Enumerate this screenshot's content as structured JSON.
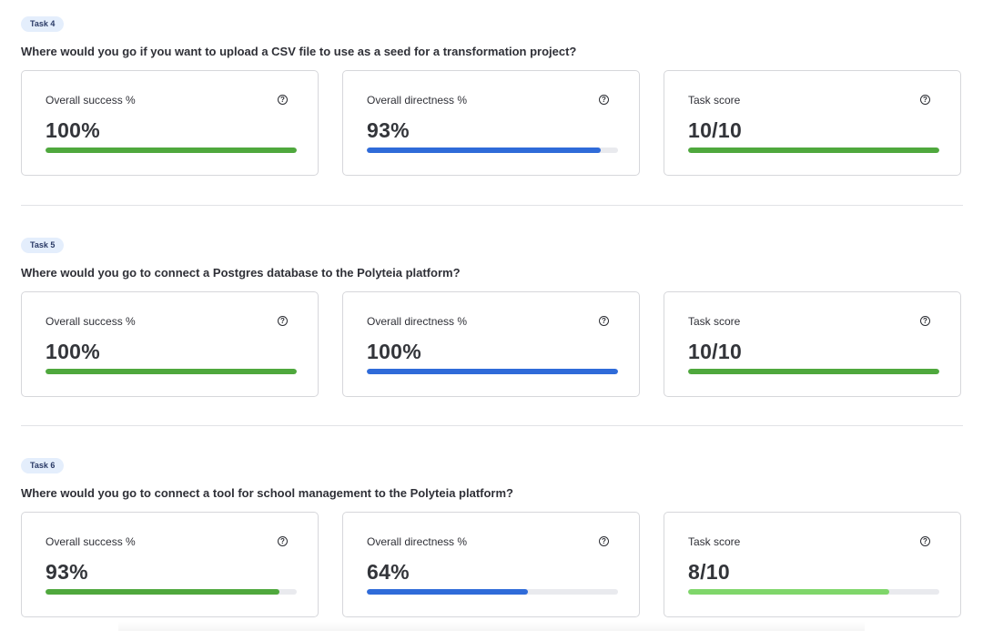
{
  "colors": {
    "success_green": "#4fa83d",
    "directness_blue": "#2f6bd9",
    "score_light_green": "#7fd66a",
    "track_gray": "#e9eaee"
  },
  "help_icon": {
    "name": "question-circle-icon",
    "glyph": "?"
  },
  "tasks": [
    {
      "badge": "Task 4",
      "question": "Where would you go if you want to upload a CSV file to use as a seed for a transformation project?",
      "metrics": [
        {
          "label": "Overall success %",
          "value": "100%",
          "fraction": 1.0,
          "color": "#4fa83d"
        },
        {
          "label": "Overall directness %",
          "value": "93%",
          "fraction": 0.93,
          "color": "#2f6bd9"
        },
        {
          "label": "Task score",
          "value": "10/10",
          "fraction": 1.0,
          "color": "#4fa83d"
        }
      ]
    },
    {
      "badge": "Task 5",
      "question": "Where would you go to connect a Postgres database to the Polyteia platform?",
      "metrics": [
        {
          "label": "Overall success %",
          "value": "100%",
          "fraction": 1.0,
          "color": "#4fa83d"
        },
        {
          "label": "Overall directness %",
          "value": "100%",
          "fraction": 1.0,
          "color": "#2f6bd9"
        },
        {
          "label": "Task score",
          "value": "10/10",
          "fraction": 1.0,
          "color": "#4fa83d"
        }
      ]
    },
    {
      "badge": "Task 6",
      "question": "Where would you go to connect a tool for school management to the Polyteia platform?",
      "metrics": [
        {
          "label": "Overall success %",
          "value": "93%",
          "fraction": 0.93,
          "color": "#4fa83d"
        },
        {
          "label": "Overall directness %",
          "value": "64%",
          "fraction": 0.64,
          "color": "#2f6bd9"
        },
        {
          "label": "Task score",
          "value": "8/10",
          "fraction": 0.8,
          "color": "#7fd66a"
        }
      ]
    }
  ]
}
